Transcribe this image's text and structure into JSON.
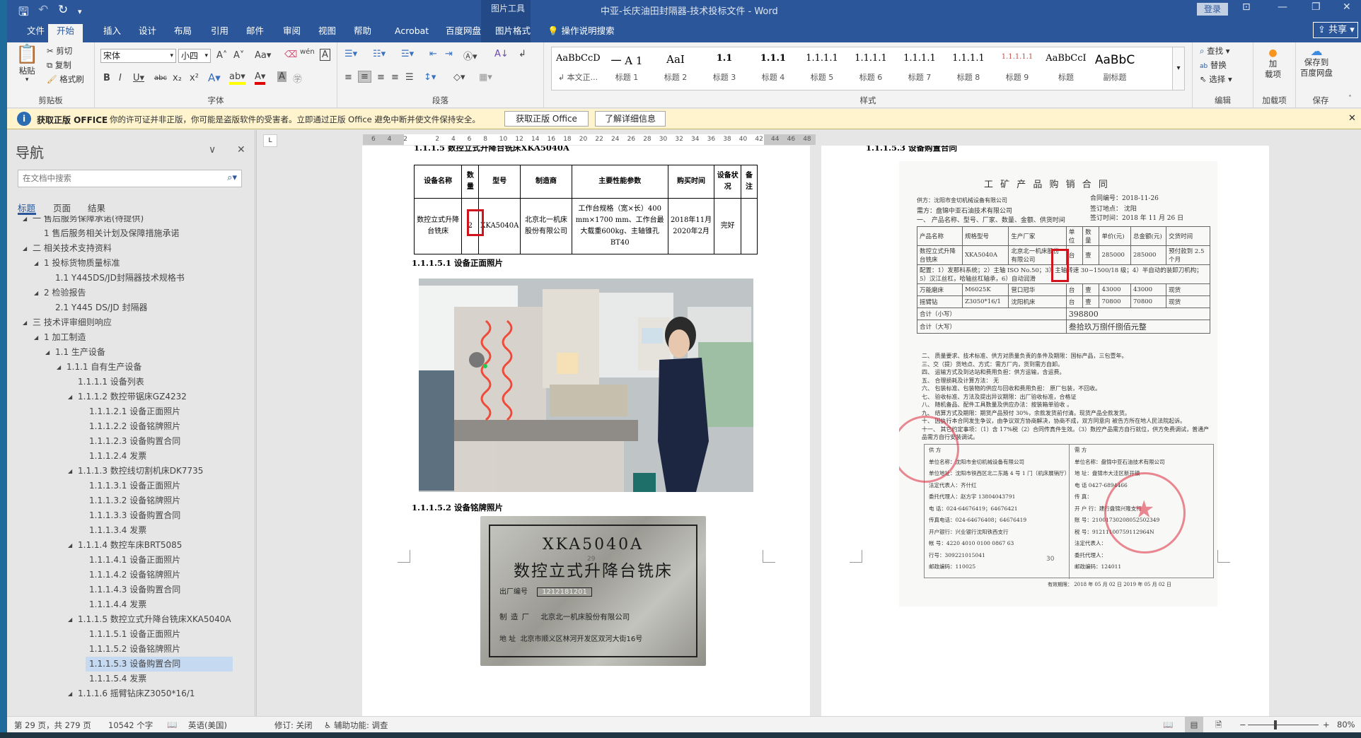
{
  "titlebar": {
    "title": "中亚-长庆油田封隔器-技术投标文件  -  Word",
    "context_tab_group": "图片工具",
    "login": "登录",
    "qat": {
      "save": "save-icon",
      "undo": "undo-icon",
      "redo": "redo-icon",
      "customize": "customize-icon"
    }
  },
  "tabs": [
    {
      "label": "文件"
    },
    {
      "label": "开始"
    },
    {
      "label": "插入"
    },
    {
      "label": "设计"
    },
    {
      "label": "布局"
    },
    {
      "label": "引用"
    },
    {
      "label": "邮件"
    },
    {
      "label": "审阅"
    },
    {
      "label": "视图"
    },
    {
      "label": "帮助"
    },
    {
      "label": "Acrobat"
    },
    {
      "label": "百度网盘"
    },
    {
      "label": "图片格式"
    }
  ],
  "tell_me": "操作说明搜索",
  "share": "共享",
  "ribbon": {
    "clipboard": {
      "label": "剪贴板",
      "paste": "粘贴",
      "cut": "剪切",
      "copy": "复制",
      "format_painter": "格式刷"
    },
    "font": {
      "label": "字体",
      "font_name": "宋体",
      "font_size": "小四"
    },
    "paragraph": {
      "label": "段落"
    },
    "styles": {
      "label": "样式",
      "items": [
        {
          "preview": "AaBbCcDdI",
          "label": "↲ 本文正..."
        },
        {
          "preview": "一  A 1",
          "label": "标题 1"
        },
        {
          "preview": "AaI",
          "label": "标题 2"
        },
        {
          "preview": "1.1",
          "label": "标题 3"
        },
        {
          "preview": "1.1.1",
          "label": "标题 4"
        },
        {
          "preview": "1.1.1.1",
          "label": "标题 5"
        },
        {
          "preview": "1.1.1.1",
          "label": "标题 6"
        },
        {
          "preview": "1.1.1.1",
          "label": "标题 7"
        },
        {
          "preview": "1.1.1.1",
          "label": "标题 8"
        },
        {
          "preview": "1.1.1.1.1",
          "label": "标题 9"
        },
        {
          "preview": "AaBbCcI",
          "label": "标题"
        },
        {
          "preview": "AaBbC",
          "label": "副标题"
        }
      ]
    },
    "editing": {
      "label": "编辑",
      "find": "查找",
      "replace": "替换",
      "select": "选择"
    },
    "addins": {
      "label": "加载项",
      "button": "加\n载项"
    },
    "save": {
      "label": "保存",
      "button_line1": "保存到",
      "button_line2": "百度网盘"
    }
  },
  "infobar": {
    "title": "获取正版 OFFICE",
    "message": "你的许可证并非正版，你可能是盗版软件的受害者。立即通过正版 Office 避免中断并使文件保持安全。",
    "btn_get": "获取正版 Office",
    "btn_learn": "了解详细信息"
  },
  "nav": {
    "title": "导航",
    "search_placeholder": "在文档中搜索",
    "tabs": [
      "标题",
      "页面",
      "结果"
    ],
    "items": [
      {
        "text": "一 售后服务保障承诺(待提供)",
        "level": 1,
        "expand": true
      },
      {
        "text": "1 售后服务相关计划及保障措施承诺",
        "level": 2,
        "expand": false
      },
      {
        "text": "二 相关技术支持资料",
        "level": 1,
        "expand": true
      },
      {
        "text": "1 投标货物质量标准",
        "level": 2,
        "expand": true
      },
      {
        "text": "1.1 Y445DS/JD封隔器技术规格书",
        "level": 3,
        "expand": false
      },
      {
        "text": "2 检验报告",
        "level": 2,
        "expand": true
      },
      {
        "text": "2.1 Y445 DS/JD 封隔器",
        "level": 3,
        "expand": false
      },
      {
        "text": "三 技术评审细则响应",
        "level": 1,
        "expand": true
      },
      {
        "text": "1 加工制造",
        "level": 2,
        "expand": true
      },
      {
        "text": "1.1 生产设备",
        "level": 3,
        "expand": true
      },
      {
        "text": "1.1.1 自有生产设备",
        "level": 4,
        "expand": true
      },
      {
        "text": "1.1.1.1 设备列表",
        "level": 5,
        "expand": false
      },
      {
        "text": "1.1.1.2 数控带锯床GZ4232",
        "level": 5,
        "expand": true
      },
      {
        "text": "1.1.1.2.1 设备正面照片",
        "level": 6,
        "expand": false
      },
      {
        "text": "1.1.1.2.2 设备铭牌照片",
        "level": 6,
        "expand": false
      },
      {
        "text": "1.1.1.2.3 设备购置合同",
        "level": 6,
        "expand": false
      },
      {
        "text": "1.1.1.2.4 发票",
        "level": 6,
        "expand": false
      },
      {
        "text": "1.1.1.3 数控线切割机床DK7735",
        "level": 5,
        "expand": true
      },
      {
        "text": "1.1.1.3.1 设备正面照片",
        "level": 6,
        "expand": false
      },
      {
        "text": "1.1.1.3.2 设备铭牌照片",
        "level": 6,
        "expand": false
      },
      {
        "text": "1.1.1.3.3 设备购置合同",
        "level": 6,
        "expand": false
      },
      {
        "text": "1.1.1.3.4 发票",
        "level": 6,
        "expand": false
      },
      {
        "text": "1.1.1.4 数控车床BRT5085",
        "level": 5,
        "expand": true
      },
      {
        "text": "1.1.1.4.1 设备正面照片",
        "level": 6,
        "expand": false
      },
      {
        "text": "1.1.1.4.2 设备铭牌照片",
        "level": 6,
        "expand": false
      },
      {
        "text": "1.1.1.4.3 设备购置合同",
        "level": 6,
        "expand": false
      },
      {
        "text": "1.1.1.4.4 发票",
        "level": 6,
        "expand": false
      },
      {
        "text": "1.1.1.5 数控立式升降台铣床XKA5040A",
        "level": 5,
        "expand": true
      },
      {
        "text": "1.1.1.5.1 设备正面照片",
        "level": 6,
        "expand": false
      },
      {
        "text": "1.1.1.5.2 设备铭牌照片",
        "level": 6,
        "expand": false
      },
      {
        "text": "1.1.1.5.3 设备购置合同",
        "level": 6,
        "expand": false,
        "selected": true
      },
      {
        "text": "1.1.1.5.4 发票",
        "level": 6,
        "expand": false
      },
      {
        "text": "1.1.1.6 摇臂钻床Z3050*16/1",
        "level": 5,
        "expand": true
      }
    ]
  },
  "ruler": {
    "ticks": [
      "6",
      "4",
      "2",
      "",
      "2",
      "4",
      "6",
      "8",
      "10",
      "12",
      "14",
      "16",
      "18",
      "20",
      "22",
      "24",
      "26",
      "28",
      "30",
      "32",
      "34",
      "36",
      "38",
      "40",
      "42",
      "44",
      "46",
      "48"
    ]
  },
  "page29": {
    "heading_top": "1.1.1.5  数控立式升降台铣床XKA5040A",
    "table": {
      "headers": [
        "设备名称",
        "数量",
        "型号",
        "制造商",
        "主要性能参数",
        "购买时间",
        "设备状况",
        "备注"
      ],
      "row": [
        "数控立式升降台铣床",
        "2",
        "XKA5040A",
        "北京北一机床股份有限公司",
        "工作台规格（宽×长）400 mm×1700 mm、工作台最大载重600kg、主轴锥孔BT40",
        "2018年11月\n2020年2月",
        "完好",
        ""
      ]
    },
    "heading_photo": "1.1.1.5.1 设备正面照片",
    "heading_plate": "1.1.1.5.2 设备铭牌照片",
    "plate": {
      "model": "XKA5040A",
      "name": "数控立式升降台铣床",
      "serial_label": "出厂编号",
      "serial": "1212181201",
      "maker_label": "制 造 厂",
      "maker": "北京北一机床股份有限公司",
      "addr_label": "地    址",
      "addr": "北京市顺义区林河开发区双河大街16号"
    },
    "page_number": "29"
  },
  "page30": {
    "heading_top": "1.1.1.5.3 设备购置合同",
    "page_number": "30",
    "contract": {
      "title": "工 矿 产 品 购 销 合 同",
      "supplier": "供方：沈阳市金切机械设备有限公司",
      "buyer": "需方：盘锦中亚石油技术有限公司",
      "contract_no": "合同编号：2018-11-26",
      "sign_place": "签订地点：  沈阳",
      "sign_time": "签订时间：2018 年 11 月 26 日",
      "section1": "一、     产品名称、型号、厂家、数量、金额、供货时间",
      "headers": [
        "产品名称",
        "规格型号",
        "生产厂家",
        "单位",
        "数量",
        "单价(元)",
        "总金额(元)",
        "交货时间"
      ],
      "rows": [
        [
          "数控立式升降台铣床",
          "XKA5040A",
          "北京北一机床股份有限公司",
          "台",
          "壹",
          "285000",
          "285000",
          "预付款到 2.5 个月"
        ],
        [
          "万能磨床",
          "M6025K",
          "营口冠华",
          "台",
          "壹",
          "43000",
          "43000",
          "现货"
        ],
        [
          "摇臂钻",
          "Z3050*16/1",
          "沈阳机床",
          "台",
          "壹",
          "70800",
          "70800",
          "现货"
        ]
      ],
      "config": "配置：1）发那科系统；2）主轴 ISO No.50；3）主轴转速 30~1500/18 级；4）半自动的装卸刀机构；5）汉江丝杠，哈轴丝杠轴承，6）自动润滑",
      "total_small_label": "合计（小写）",
      "total_small": "398800",
      "total_big_label": "合计（大写）",
      "total_big": "叁拾玖万捌仟捌佰元整",
      "terms": [
        "二、 质量要求、技术标准、供方对质量负责的条件及期限：国标产品，三包壹年。",
        "三、交（提）货地点、方式：需方厂内，货到需方自卸。",
        "四、 运输方式及到达站和费用负担：供方运输，含运费。",
        "五、 合理损耗及计算方法：  无",
        "六、 包装标准、包装物的供应与回收和费用负担：  原厂包装，不回收。",
        "七、 验收标准、方法及提出异议期限：出厂验收标准，合格证",
        "八、 随机备品、配件工具数量及供应办法：按装箱单验收 。",
        "九、 结算方式及期限：期货产品预付 30%，余款发货前付清。现货产品全款发货。",
        "十、 因执行本合同发生争议，由争议双方协商解决，协商不成，双方同意向 被告方所在地人民法院起诉。",
        "十一、 其它约定事项：（1）含 17%税（2）合同传真件生效。（3）数控产品需方自行就位，供方免费调试，普通产品需方自行安装调试。"
      ],
      "supplier_block": [
        "供    方",
        "单位名称：沈阳市金切机械设备有限公司",
        "单位地址：沈阳市铁西区北二东路 4 号 1 门（机床展销厅）",
        "法定代表人：齐什红",
        "委托代理人：赵方宇 13804043791",
        "电    话：024-64676419；64676421",
        "传真电话：024-64676408；64676419",
        "开户银行：兴业银行沈阳铁西支行",
        "帐    号：4220 4010 0100 0867 63",
        "行号：309221015041",
        "邮政编码：110025"
      ],
      "buyer_block": [
        "需    方",
        "单位名称：盘锦中亚石油技术有限公司",
        "地    址：盘锦市大洼区新开镇",
        "电    话 0427-6894466",
        "传    真：",
        "开 户 行：建行盘锦兴隆支行",
        "账    号：21001730208052502349",
        "税    号：91211100759112964N",
        "法定代表人：",
        "委托代理人：",
        "邮政编码：124011"
      ],
      "validity": "有效期限：  2018 年 05 月 02 日 2019 年 05 月 02 日"
    }
  },
  "status": {
    "page": "第 29 页，共 279 页",
    "words": "10542 个字",
    "language": "英语(美国)",
    "track": "修订: 关闭",
    "accessibility": "辅助功能: 调查",
    "zoom": "80%",
    "zoom_percent": 80
  },
  "colors": {
    "brand": "#2b579a",
    "highlight": "#c5d9f1",
    "info": "#fff4ce",
    "mark": "#d0141e"
  }
}
